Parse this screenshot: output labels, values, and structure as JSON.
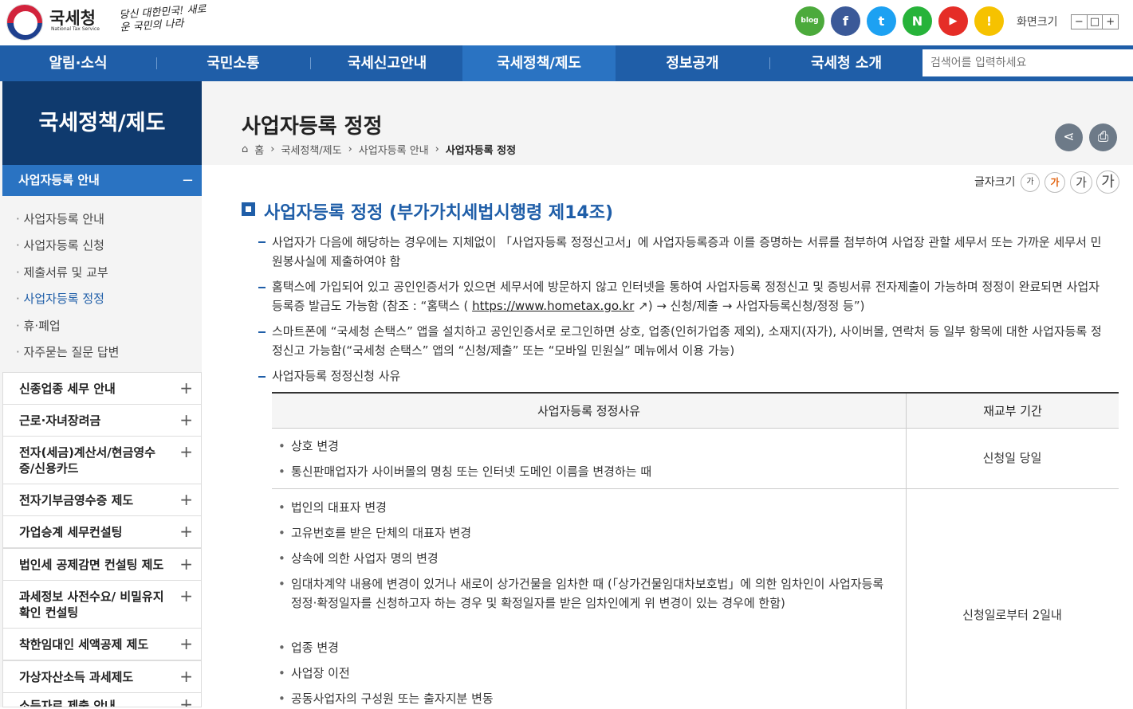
{
  "header": {
    "brand": "국세청",
    "brand_en": "National Tax Service",
    "slogan": "당신 대한민국! 새로운 국민의 나라",
    "sns": [
      {
        "name": "blog-icon",
        "glyph": "blog",
        "color": "#4caa3c"
      },
      {
        "name": "facebook-icon",
        "glyph": "f",
        "color": "#3b5998"
      },
      {
        "name": "twitter-icon",
        "glyph": "t",
        "color": "#1da1f2"
      },
      {
        "name": "naver-post-icon",
        "glyph": "N",
        "color": "#27b33a"
      },
      {
        "name": "youtube-icon",
        "glyph": "▶",
        "color": "#e52d27"
      },
      {
        "name": "kakao-icon",
        "glyph": "!",
        "color": "#f6c200"
      }
    ],
    "screen_size_label": "화면크기",
    "zoom": [
      "−",
      "□",
      "+"
    ]
  },
  "nav": {
    "items": [
      "알림·소식",
      "국민소통",
      "국세신고안내",
      "국세정책/제도",
      "정보공개",
      "국세청 소개"
    ],
    "active_index": 3,
    "search_placeholder": "검색어를 입력하세요"
  },
  "sidebar": {
    "title": "국세정책/제도",
    "current": "사업자등록 안내",
    "current_toggle": "−",
    "subitems": [
      "사업자등록 안내",
      "사업자등록 신청",
      "제출서류 및 교부",
      "사업자등록 정정",
      "휴·폐업",
      "자주묻는 질문 답변"
    ],
    "active_sub": 3,
    "groups": [
      "신종업종 세무 안내",
      "근로·자녀장려금",
      "전자(세금)계산서/현금영수증/신용카드",
      "전자기부금영수증 제도",
      "가업승계 세무컨설팅",
      "법인세 공제감면 컨설팅 제도",
      "과세정보 사전수요/ 비밀유지 확인 컨설팅",
      "착한임대인 세액공제 제도",
      "가상자산소득 과세제도",
      "소득자료 제출 안내"
    ],
    "group_toggle": "+"
  },
  "page": {
    "title": "사업자등록 정정",
    "breadcrumb": [
      "홈",
      "국세정책/제도",
      "사업자등록 안내",
      "사업자등록 정정"
    ],
    "share_icon": "share-icon",
    "print_icon": "print-icon",
    "font_size_label": "글자크기",
    "font_sizes": [
      "가",
      "가",
      "가",
      "가"
    ]
  },
  "section": {
    "title": "사업자등록 정정 (부가가치세법시행령 제14조)",
    "para1": "사업자가 다음에 해당하는 경우에는 지체없이 「사업자등록 정정신고서」에 사업자등록증과 이를 증명하는 서류를 첨부하여 사업장 관할 세무서 또는 가까운 세무서 민원봉사실에 제출하여야 함",
    "para2_a": "홈택스에 가입되어 있고 공인인증서가 있으면 세무서에 방문하지 않고 인터넷을 통하여 사업자등록 정정신고 및 증빙서류 전자제출이 가능하며 정정이 완료되면 사업자등록증 발급도 가능함 (참조 : “홈택스 ( ",
    "para2_link": "https://www.hometax.go.kr",
    "para2_b": " ↗) → 신청/제출 → 사업자등록신청/정정 등”)",
    "para3": "스마트폰에 “국세청 손택스” 앱을 설치하고 공인인증서로 로그인하면 상호, 업종(인허가업종 제외), 소재지(자가), 사이버몰, 연락처 등 일부 항목에 대한 사업자등록 정정신고 가능함(“국세청 손택스” 앱의 “신청/제출” 또는 “모바일 민원실” 메뉴에서 이용 가능)",
    "para4": "사업자등록 정정신청 사유"
  },
  "table": {
    "headers": [
      "사업자등록 정정사유",
      "재교부 기간"
    ],
    "rows": [
      {
        "reasons": [
          "상호 변경",
          "통신판매업자가 사이버몰의 명칭 또는 인터넷 도메인 이름을 변경하는 때"
        ],
        "period": "신청일 당일"
      },
      {
        "reasons": [
          "법인의 대표자 변경",
          "고유번호를 받은 단체의 대표자 변경",
          "상속에 의한 사업자 명의 변경",
          "임대차계약 내용에 변경이 있거나 새로이 상가건물을 임차한 때 (「상가건물임대차보호법」에 의한 임차인이 사업자등록 정정·확정일자를 신청하고자 하는 경우 및 확정일자를 받은 임차인에게 위 변경이 있는 경우에 한함)",
          "업종 변경",
          "사업장 이전",
          "공동사업자의 구성원 또는 출자지분 변동"
        ],
        "period": "신청일로부터 2일내"
      }
    ]
  }
}
